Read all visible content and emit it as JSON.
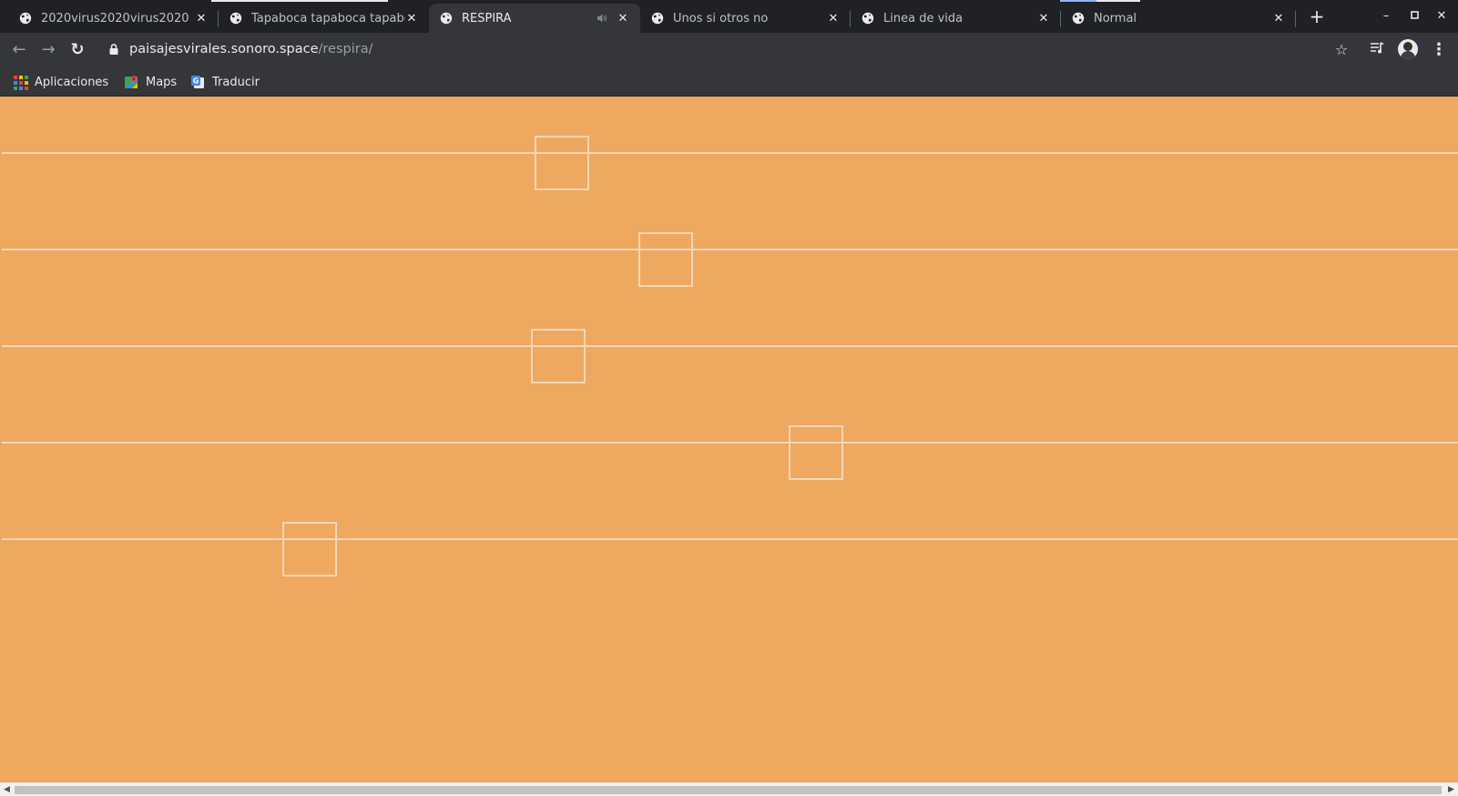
{
  "browser": {
    "tabs": [
      {
        "title": "2020virus2020virus2020",
        "active": false
      },
      {
        "title": "Tapaboca tapaboca tapaboca",
        "active": false
      },
      {
        "title": "RESPIRA",
        "active": true,
        "audio": true
      },
      {
        "title": "Unos si otros no",
        "active": false
      },
      {
        "title": "Linea de vida",
        "active": false
      },
      {
        "title": "Normal",
        "active": false
      }
    ],
    "url_host": "paisajesvirales.sonoro.space",
    "url_path": "/respira/",
    "bookmarks": [
      {
        "label": "Aplicaciones",
        "icon": "apps-grid-icon"
      },
      {
        "label": "Maps",
        "icon": "maps-icon"
      },
      {
        "label": "Traducir",
        "icon": "translate-icon"
      }
    ],
    "icons": {
      "new_tab": "+",
      "minimize": "–",
      "maximize": "▫",
      "close": "✕",
      "back": "←",
      "forward": "→",
      "reload": "↻",
      "star": "☆",
      "menu": "⋮",
      "media": "≡"
    }
  },
  "page": {
    "background": "#efa860",
    "line_color": "#f4d6b4",
    "rows": 5
  },
  "colors": {
    "tabstrip": "#202124",
    "toolbar": "#35363a"
  }
}
